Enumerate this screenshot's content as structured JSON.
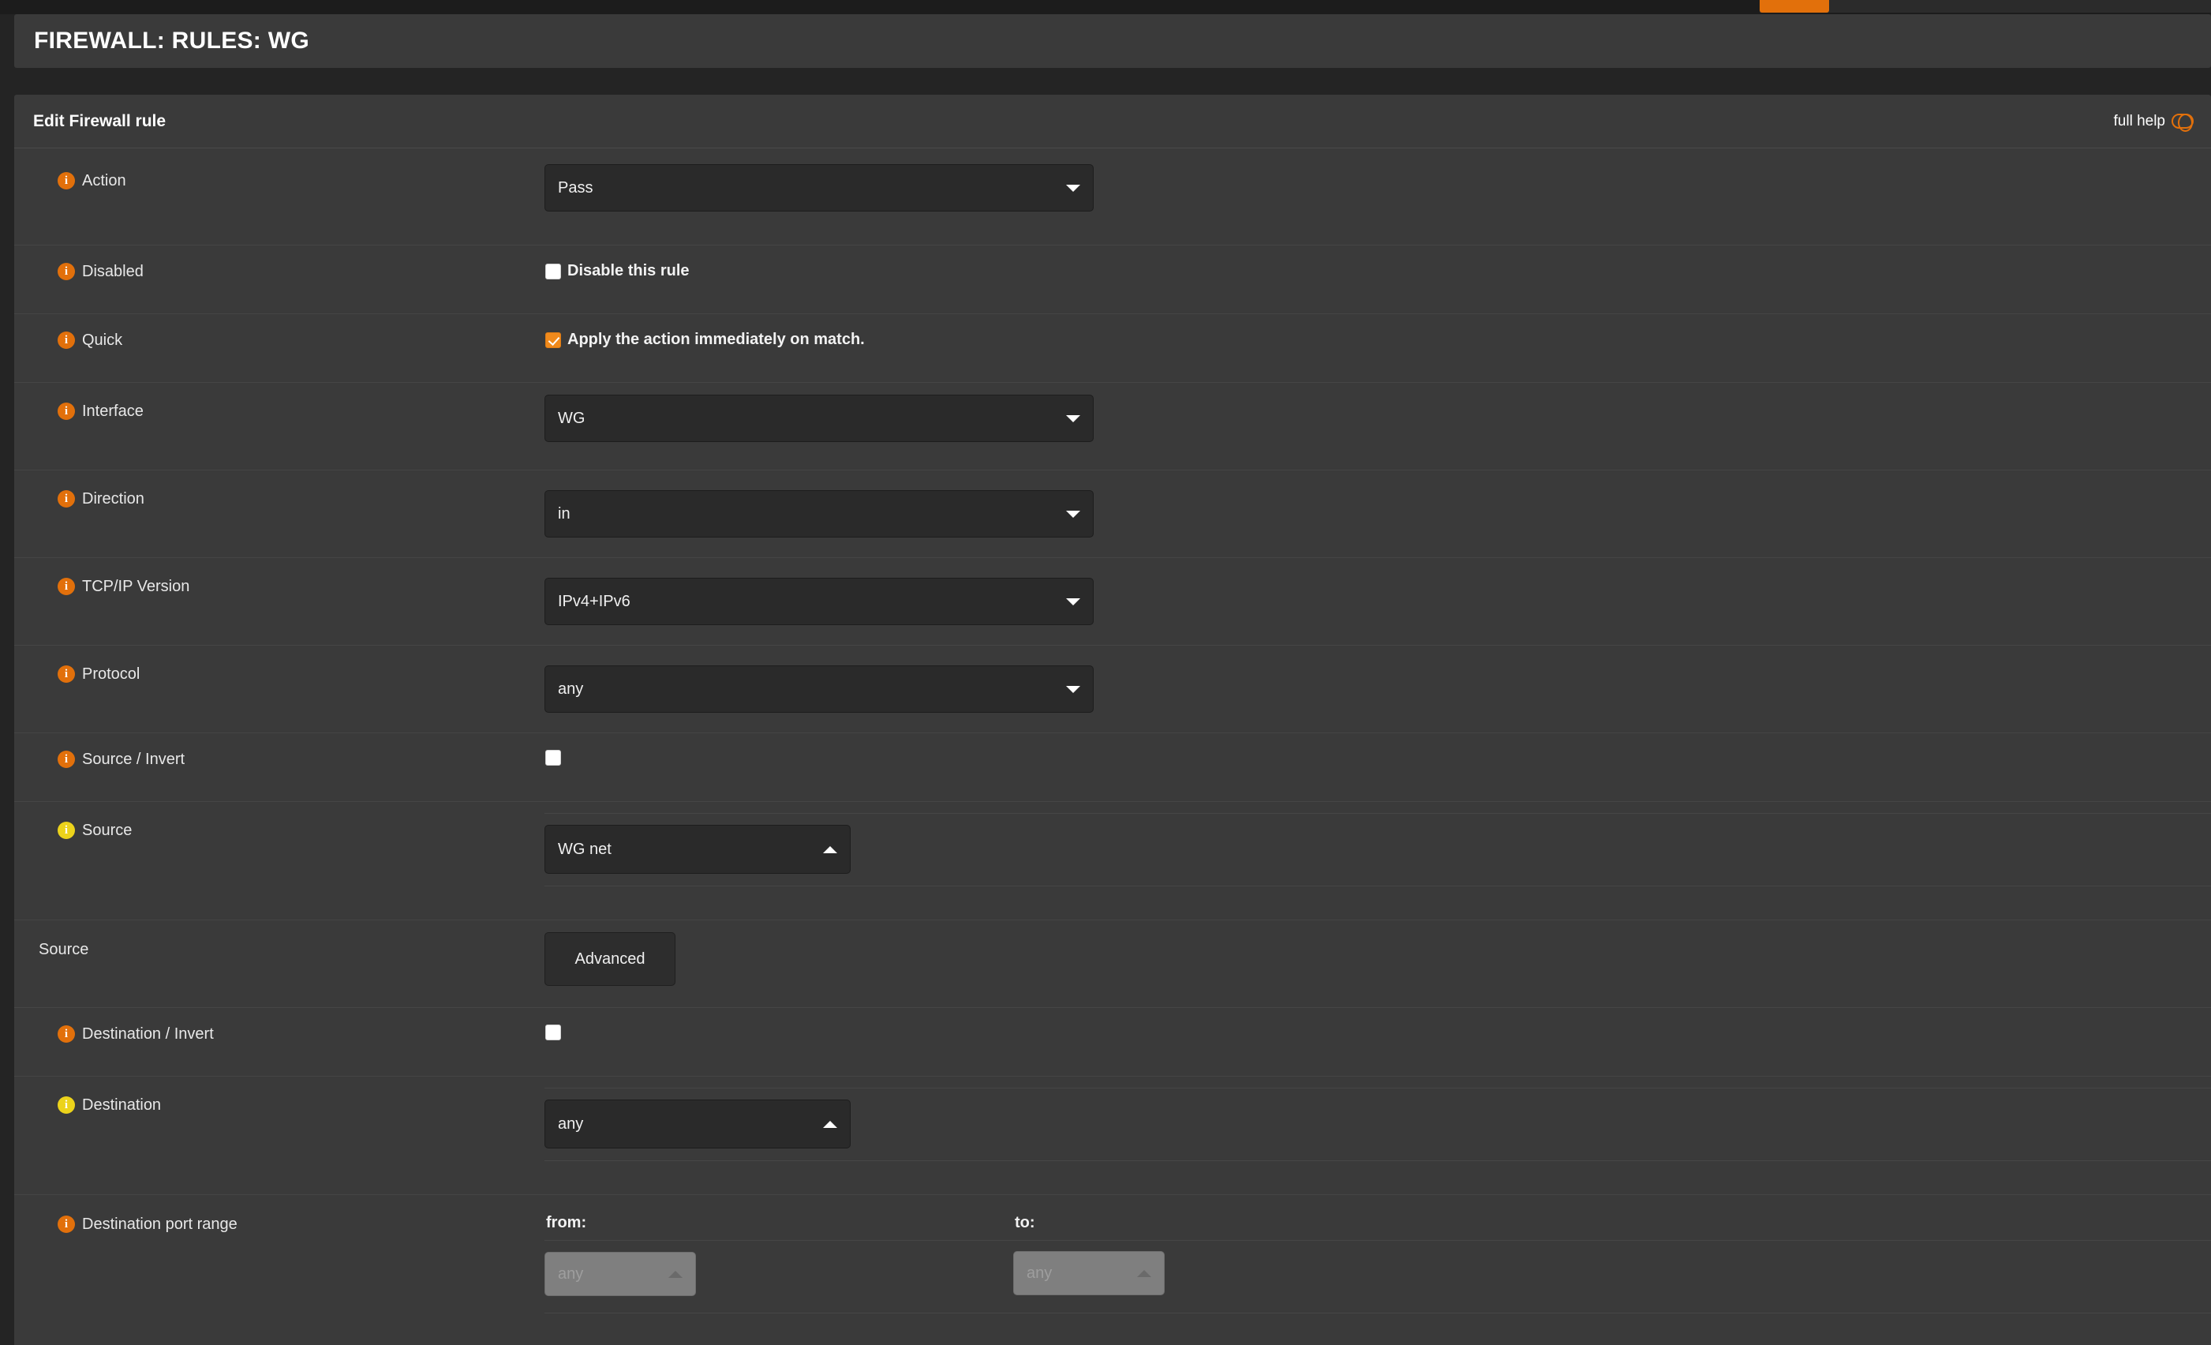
{
  "window": {
    "top_tab_color": "#e2700b"
  },
  "page_title": "FIREWALL: RULES: WG",
  "panel": {
    "heading": "Edit Firewall rule",
    "full_help_label": "full help",
    "help_toggle_icon": "toggle-off-icon"
  },
  "rows": {
    "action": {
      "label": "Action",
      "icon": "info-icon",
      "value": "Pass"
    },
    "disabled": {
      "label": "Disabled",
      "icon": "info-icon",
      "checkbox_label": "Disable this rule",
      "checked": false
    },
    "quick": {
      "label": "Quick",
      "icon": "info-icon",
      "checkbox_label": "Apply the action immediately on match.",
      "checked": true
    },
    "interface": {
      "label": "Interface",
      "icon": "info-icon",
      "value": "WG"
    },
    "direction": {
      "label": "Direction",
      "icon": "info-icon",
      "value": "in"
    },
    "tcpip_version": {
      "label": "TCP/IP Version",
      "icon": "info-icon",
      "value": "IPv4+IPv6"
    },
    "protocol": {
      "label": "Protocol",
      "icon": "info-icon",
      "value": "any"
    },
    "source_invert": {
      "label": "Source / Invert",
      "icon": "info-icon",
      "checked": false
    },
    "source": {
      "label": "Source",
      "icon": "info-icon-yellow",
      "value": "WG net"
    },
    "source_advanced": {
      "label": "Source",
      "button_label": "Advanced"
    },
    "destination_invert": {
      "label": "Destination / Invert",
      "icon": "info-icon",
      "checked": false
    },
    "destination": {
      "label": "Destination",
      "icon": "info-icon-yellow",
      "value": "any"
    },
    "destination_port_range": {
      "label": "Destination port range",
      "icon": "info-icon",
      "from_label": "from:",
      "from_value": "any",
      "to_label": "to:",
      "to_value": "any",
      "disabled": true
    }
  },
  "colors": {
    "accent_orange": "#e2700b",
    "checkbox_checked": "#f08a1c",
    "info_yellow": "#ecd31b",
    "panel_bg": "#3a3a3a",
    "page_bg": "#242424",
    "field_bg": "#2a2a2a"
  }
}
